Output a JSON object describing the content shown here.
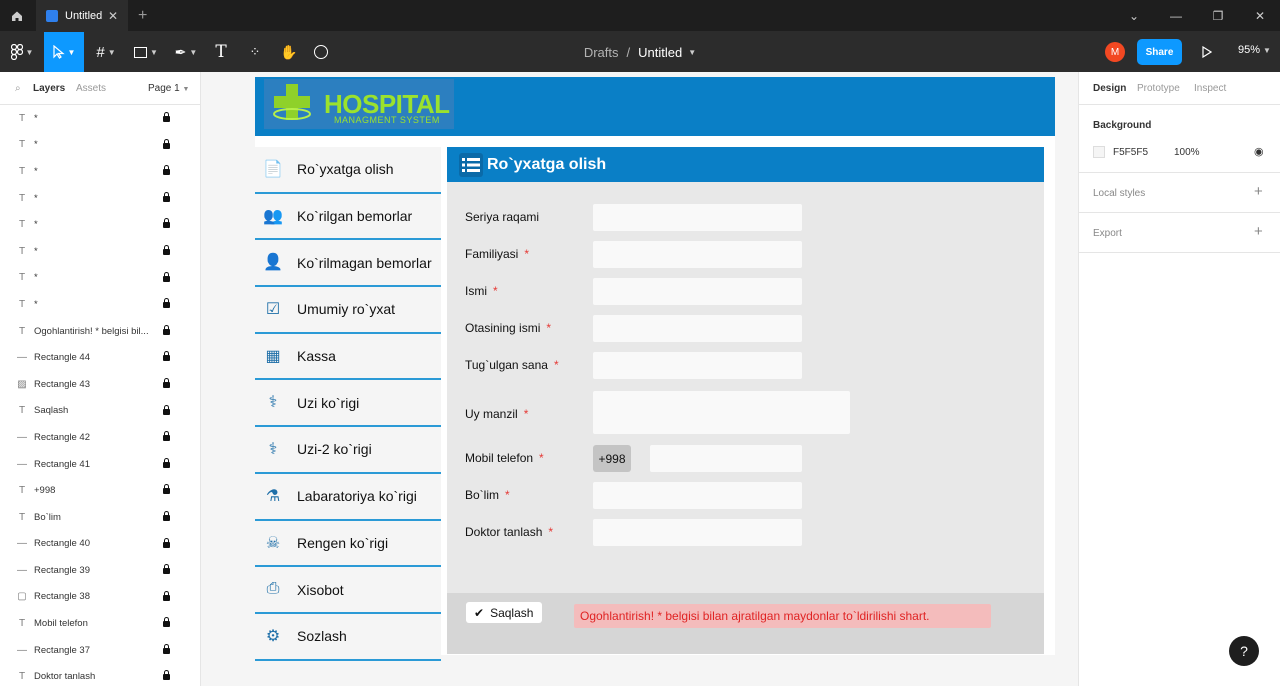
{
  "titlebar": {
    "tab_title": "Untitled",
    "tab_close": "✕",
    "new_tab": "+"
  },
  "toolbar": {
    "breadcrumb_root": "Drafts",
    "breadcrumb_sep": "/",
    "file_name": "Untitled",
    "avatar_initial": "M",
    "share_label": "Share",
    "zoom_level": "95%"
  },
  "left_panel": {
    "tab_layers": "Layers",
    "tab_assets": "Assets",
    "page_label": "Page 1",
    "layers": [
      {
        "icon": "text",
        "name": "*"
      },
      {
        "icon": "text",
        "name": "*"
      },
      {
        "icon": "text",
        "name": "*"
      },
      {
        "icon": "text",
        "name": "*"
      },
      {
        "icon": "text",
        "name": "*"
      },
      {
        "icon": "text",
        "name": "*"
      },
      {
        "icon": "text",
        "name": "*"
      },
      {
        "icon": "text",
        "name": "*"
      },
      {
        "icon": "text",
        "name": "Ogohlantirish! * belgisi bil..."
      },
      {
        "icon": "line",
        "name": "Rectangle 44"
      },
      {
        "icon": "image",
        "name": "Rectangle 43"
      },
      {
        "icon": "text",
        "name": "Saqlash"
      },
      {
        "icon": "line",
        "name": "Rectangle 42"
      },
      {
        "icon": "line",
        "name": "Rectangle 41"
      },
      {
        "icon": "text",
        "name": "+998"
      },
      {
        "icon": "text",
        "name": "Bo`lim"
      },
      {
        "icon": "line",
        "name": "Rectangle 40"
      },
      {
        "icon": "line",
        "name": "Rectangle 39"
      },
      {
        "icon": "rect",
        "name": "Rectangle 38"
      },
      {
        "icon": "text",
        "name": "Mobil telefon"
      },
      {
        "icon": "line",
        "name": "Rectangle 37"
      },
      {
        "icon": "text",
        "name": "Doktor tanlash"
      }
    ]
  },
  "right_panel": {
    "tab_design": "Design",
    "tab_prototype": "Prototype",
    "tab_inspect": "Inspect",
    "background_title": "Background",
    "background_hex": "F5F5F5",
    "background_opacity": "100%",
    "local_styles": "Local styles",
    "export": "Export"
  },
  "design": {
    "logo_title": "HOSPITAL",
    "logo_subtitle": "MANAGMENT SYSTEM",
    "menu": [
      {
        "label": "Ro`yxatga olish",
        "icon": "document-icon"
      },
      {
        "label": "Ko`rilgan bemorlar",
        "icon": "patients-icon"
      },
      {
        "label": "Ko`rilmagan bemorlar",
        "icon": "user-icon"
      },
      {
        "label": "Umumiy ro`yxat",
        "icon": "checklist-icon"
      },
      {
        "label": "Kassa",
        "icon": "calculator-icon"
      },
      {
        "label": "Uzi ko`rigi",
        "icon": "ultrasound-icon"
      },
      {
        "label": "Uzi-2 ko`rigi",
        "icon": "ultrasound-icon"
      },
      {
        "label": "Labaratoriya ko`rigi",
        "icon": "flask-icon"
      },
      {
        "label": "Rengen ko`rigi",
        "icon": "xray-icon"
      },
      {
        "label": "Xisobot",
        "icon": "printer-icon"
      },
      {
        "label": "Sozlash",
        "icon": "settings-icon"
      }
    ],
    "panel_title": "Ro`yxatga olish",
    "fields": [
      {
        "label": "Seriya raqami",
        "required": ""
      },
      {
        "label": "Familiyasi",
        "required": "*"
      },
      {
        "label": "Ismi",
        "required": "*"
      },
      {
        "label": "Otasining ismi",
        "required": "*"
      },
      {
        "label": "Tug`ulgan sana",
        "required": "*"
      },
      {
        "label": "Uy manzil",
        "required": "*"
      },
      {
        "label": "Mobil telefon",
        "required": "*"
      },
      {
        "label": "Bo`lim",
        "required": "*"
      },
      {
        "label": "Doktor tanlash",
        "required": "*"
      }
    ],
    "phone_prefix": "+998",
    "save_label": "Saqlash",
    "warning": "Ogohlantirish!   * belgisi bilan ajratilgan maydonlar to`ldirilishi shart."
  },
  "colors": {
    "accent": "#0d99ff",
    "header_blue": "#0a7fc6",
    "menu_border": "#2b9ad6",
    "warning_bg": "#f4bcbc",
    "warning_text": "#e02424"
  }
}
